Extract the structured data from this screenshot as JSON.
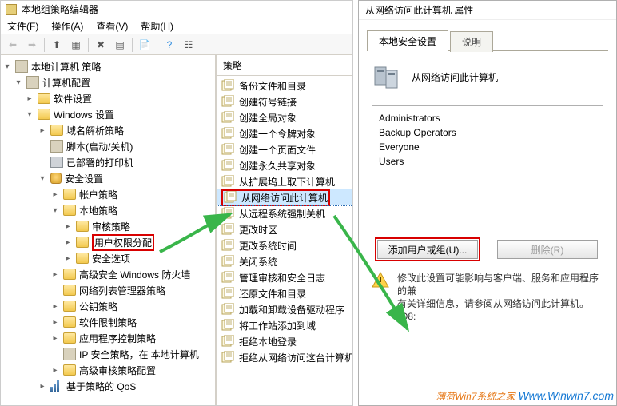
{
  "window": {
    "title": "本地组策略编辑器",
    "prop_title": "从网络访问此计算机 属性"
  },
  "menu": {
    "file": "文件(F)",
    "action": "操作(A)",
    "view": "查看(V)",
    "help": "帮助(H)"
  },
  "tree": {
    "root": "本地计算机 策略",
    "computer_config": "计算机配置",
    "software": "软件设置",
    "windows": "Windows 设置",
    "dns": "域名解析策略",
    "scripts": "脚本(启动/关机)",
    "printers": "已部署的打印机",
    "security": "安全设置",
    "account": "帐户策略",
    "local": "本地策略",
    "audit": "审核策略",
    "user_rights": "用户权限分配",
    "sec_options": "安全选项",
    "wfas": "高级安全 Windows 防火墙",
    "netlist": "网络列表管理器策略",
    "pubkey": "公钥策略",
    "srp": "软件限制策略",
    "appctrl": "应用程序控制策略",
    "ipsec": "IP 安全策略，在 本地计算机",
    "adv_audit": "高级审核策略配置",
    "qos": "基于策略的 QoS"
  },
  "policyHeader": "策略",
  "policies": [
    "备份文件和目录",
    "创建符号链接",
    "创建全局对象",
    "创建一个令牌对象",
    "创建一个页面文件",
    "创建永久共享对象",
    "从扩展坞上取下计算机",
    "从网络访问此计算机",
    "从远程系统强制关机",
    "更改时区",
    "更改系统时间",
    "关闭系统",
    "管理审核和安全日志",
    "还原文件和目录",
    "加载和卸载设备驱动程序",
    "将工作站添加到域",
    "拒绝本地登录",
    "拒绝从网络访问这台计算机"
  ],
  "selectedPolicyIndex": 7,
  "prop": {
    "tab_local": "本地安全设置",
    "tab_explain": "说明",
    "policy_name": "从网络访问此计算机",
    "principals": [
      "Administrators",
      "Backup Operators",
      "Everyone",
      "Users"
    ],
    "add_btn": "添加用户或组(U)...",
    "remove_btn": "删除(R)",
    "warn1": "修改此设置可能影响与客户端、服务和应用程序的兼",
    "warn2": "有关详细信息，请参阅从网络访问此计算机。(Q8:"
  },
  "watermark": {
    "cn": "薄荷Win7系统之家",
    "en": "Www.Winwin7.com"
  }
}
